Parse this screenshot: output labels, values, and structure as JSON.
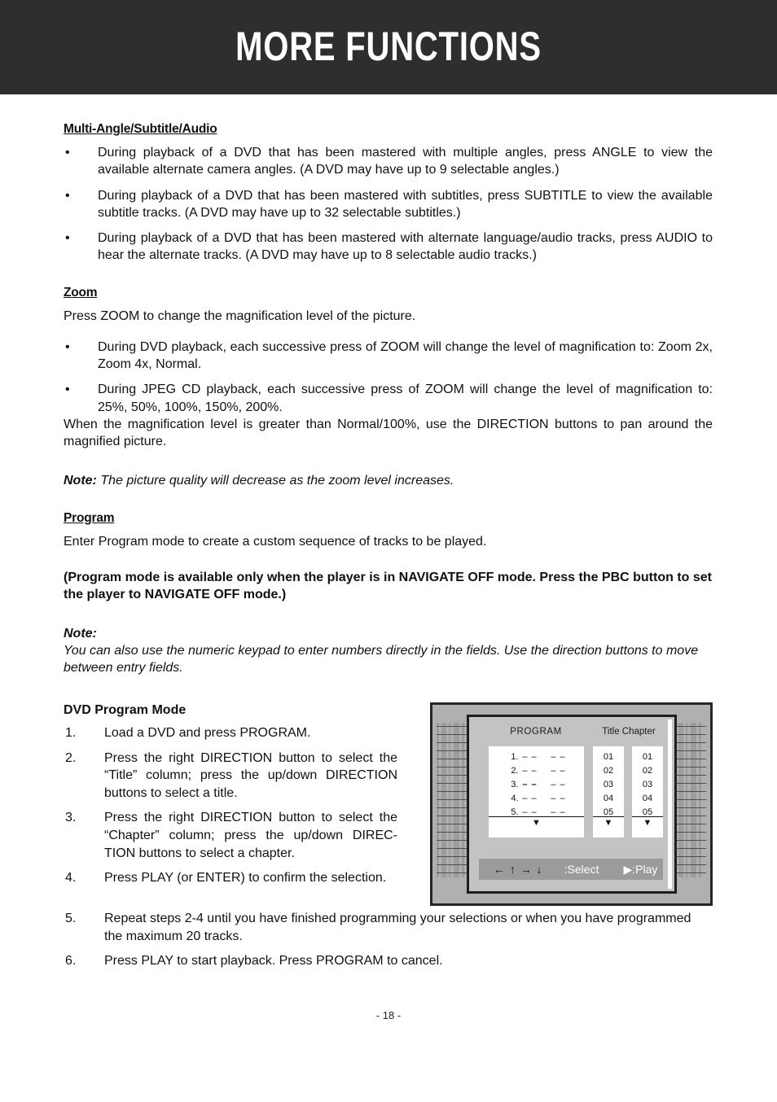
{
  "header": {
    "title": "MORE FUNCTIONS",
    "background_color": "#2e2e2e",
    "text_color": "#ffffff"
  },
  "sections": {
    "multi_angle": {
      "heading": "Multi-Angle/Subtitle/Audio",
      "bullet_char": "•",
      "bullets": [
        "During playback of a DVD that has been mastered with multiple angles, press ANGLE to view the available alternate camera angles. (A DVD may have up to 9 selectable angles.)",
        "During playback of a DVD that has been mastered with subtitles, press SUBTITLE to view the available subtitle tracks. (A DVD may have up to 32 selectable subtitles.)",
        "During playback of a DVD that has been mastered with alternate language/audio tracks, press AUDIO to hear the alternate tracks. (A DVD may have up to 8 selectable audio tracks.)"
      ]
    },
    "zoom": {
      "heading": "Zoom",
      "intro": "Press ZOOM to change the magnification level of the picture.",
      "bullets": [
        "During DVD playback, each successive press of ZOOM will change the level of magnification to: Zoom 2x, Zoom 4x, Normal.",
        "During JPEG CD playback, each successive press of ZOOM will change the level of magnification to: 25%, 50%, 100%, 150%, 200%."
      ],
      "outro": "When the magnification level is greater than Normal/100%, use the DIRECTION buttons to pan around the magnified picture.",
      "note_label": "Note:",
      "note_text": "The picture quality will decrease as the zoom level increases."
    },
    "program": {
      "heading": "Program",
      "intro": "Enter Program mode to create a custom sequence of tracks to be played.",
      "bold_note": "(Program mode is available only when the player is in NAVIGATE OFF mode. Press the PBC button to set the player to NAVIGATE OFF mode.)",
      "note_label": "Note:",
      "note_text": "You can also use the numeric keypad to enter numbers directly in the fields. Use the direction buttons to move between entry fields."
    },
    "dvd_program_mode": {
      "heading": "DVD Program Mode",
      "steps": [
        {
          "num": "1.",
          "text": "Load a DVD and press PROGRAM."
        },
        {
          "num": "2.",
          "text": "Press the right DIRECTION button to select the “Title” column; press the up/down DIRECTION buttons to select a title."
        },
        {
          "num": "3.",
          "text": "Press the right DIRECTION button to select the “Chapter” column; press the up/down DIREC-TION buttons to select a chapter."
        },
        {
          "num": "4.",
          "text": "Press PLAY (or ENTER) to confirm the selection."
        }
      ],
      "steps_tail": [
        {
          "num": "5.",
          "text": "Repeat steps 2-4 until you have finished programming your selections or when you have programmed the maximum 20 tracks."
        },
        {
          "num": "6.",
          "text": "Press PLAY to start playback. Press PROGRAM to cancel."
        }
      ]
    }
  },
  "osd": {
    "program_header": "PROGRAM",
    "title_chapter_header": "Title Chapter",
    "program_rows": [
      {
        "num": "1.",
        "title": "– –",
        "chapter": "– –",
        "highlighted": false
      },
      {
        "num": "2.",
        "title": "– –",
        "chapter": "– –",
        "highlighted": false
      },
      {
        "num": "3.",
        "title": "– –",
        "chapter": "– –",
        "highlighted": true
      },
      {
        "num": "4.",
        "title": "– –",
        "chapter": "– –",
        "highlighted": false
      },
      {
        "num": "5.",
        "title": "– –",
        "chapter": "– –",
        "highlighted": false
      }
    ],
    "title_values": [
      "01",
      "02",
      "03",
      "04",
      "05"
    ],
    "chapter_values": [
      "01",
      "02",
      "03",
      "04",
      "05"
    ],
    "scroll_caret": "▼",
    "bottom_bar": {
      "arrows": "← ↑ → ↓",
      "select_label": ":Select",
      "play_label": "▶:Play"
    },
    "colors": {
      "outer_bg": "#b0b0b0",
      "screen_bg": "#c3c3c3",
      "field_bg": "#ffffff",
      "bar_bg": "#9b9b9b",
      "border": "#262626"
    }
  },
  "footer": {
    "page_number": "- 18 -"
  }
}
